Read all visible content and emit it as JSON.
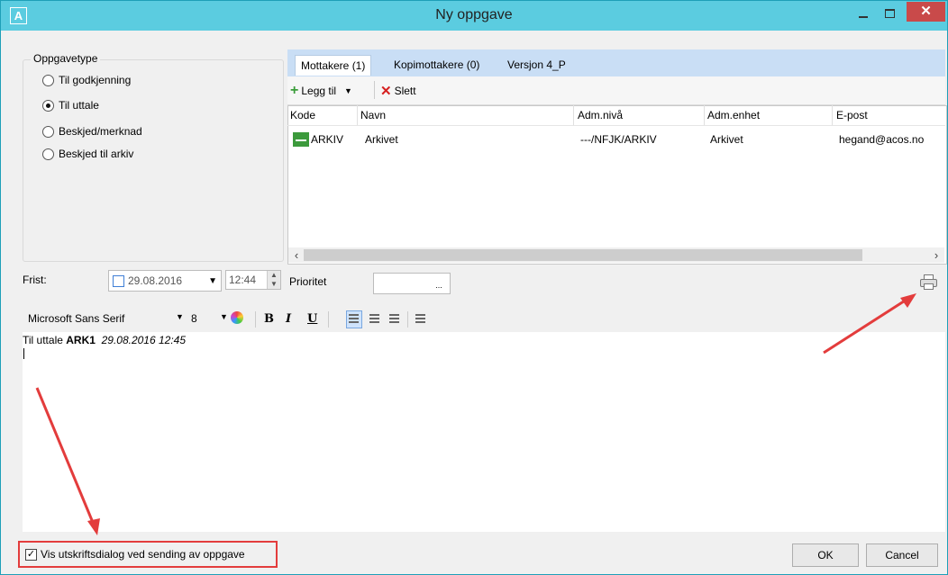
{
  "window": {
    "title": "Ny oppgave",
    "app_icon_letter": "A"
  },
  "oppgavetype": {
    "legend": "Oppgavetype",
    "options": [
      {
        "label": "Til godkjenning",
        "selected": false
      },
      {
        "label": "Til uttale",
        "selected": true
      },
      {
        "label": "Beskjed/merknad",
        "selected": false
      },
      {
        "label": "Beskjed til arkiv",
        "selected": false
      }
    ]
  },
  "tabs": [
    "Mottakere (1)",
    "Kopimottakere (0)",
    "Versjon 4_P"
  ],
  "toolbar": {
    "add_label": "Legg til",
    "delete_label": "Slett"
  },
  "table": {
    "columns": [
      "Kode",
      "Navn",
      "Adm.nivå",
      "Adm.enhet",
      "E-post"
    ],
    "rows": [
      {
        "kode": "ARKIV",
        "navn": "Arkivet",
        "adm_niva": "---/NFJK/ARKIV",
        "adm_enhet": "Arkivet",
        "epost": "hegand@acos.no"
      }
    ]
  },
  "frist": {
    "label": "Frist:",
    "date": "29.08.2016",
    "time": "12:44"
  },
  "prioritet": {
    "label": "Prioritet",
    "button": "..."
  },
  "editor": {
    "font": "Microsoft Sans Serif",
    "size": "8",
    "format_bold": "B",
    "format_italic": "I",
    "format_underline": "U",
    "content_prefix": "Til uttale",
    "content_code": "ARK1",
    "content_date": "29.08.2016 12:45"
  },
  "footer": {
    "checkbox_label": "Vis utskriftsdialog ved sending av oppgave",
    "checkbox_checked": true,
    "ok": "OK",
    "cancel": "Cancel"
  },
  "colors": {
    "titlebar": "#5bcce0",
    "close": "#c94a4a",
    "highlight_red": "#e33c3c",
    "tabs_bg": "#c9def5"
  }
}
